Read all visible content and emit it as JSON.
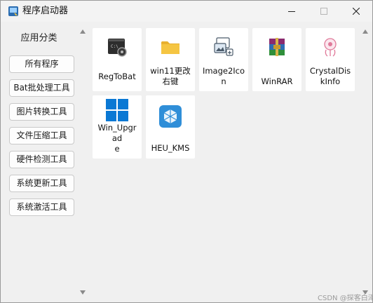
{
  "window": {
    "title": "程序启动器",
    "controls": {
      "minimize": "minimize",
      "maximize": "maximize",
      "close": "close"
    }
  },
  "sidebar": {
    "title": "应用分类",
    "items": [
      {
        "label": "所有程序"
      },
      {
        "label": "Bat批处理工具"
      },
      {
        "label": "图片转换工具"
      },
      {
        "label": "文件压缩工具"
      },
      {
        "label": "硬件检测工具"
      },
      {
        "label": "系统更新工具"
      },
      {
        "label": "系统激活工具"
      }
    ]
  },
  "apps": [
    {
      "name": "RegToBat",
      "label_lines": [
        "RegToBat"
      ],
      "icon": "regtobat-icon"
    },
    {
      "name": "win11更改右键",
      "label_lines": [
        "win11更改",
        "右键"
      ],
      "icon": "folder-icon"
    },
    {
      "name": "Image2Icon",
      "label_lines": [
        "Image2Ico",
        "n"
      ],
      "icon": "image2icon-icon"
    },
    {
      "name": "WinRAR",
      "label_lines": [
        "WinRAR"
      ],
      "icon": "winrar-icon"
    },
    {
      "name": "CrystalDiskInfo",
      "label_lines": [
        "CrystalDis",
        "kInfo"
      ],
      "icon": "crystaldiskinfo-icon"
    },
    {
      "name": "Win_Upgrade",
      "label_lines": [
        "Win_Upgr",
        "ad",
        "e"
      ],
      "icon": "windows-logo-icon"
    },
    {
      "name": "HEU_KMS",
      "label_lines": [
        "HEU_KMS"
      ],
      "icon": "heu-kms-icon"
    }
  ],
  "watermark": "CSDN @探客白泽",
  "colors": {
    "window_bg": "#f0f0f0",
    "tile_bg": "#ffffff",
    "windows_blue": "#0a78d4",
    "folder_yellow": "#f5c542"
  }
}
